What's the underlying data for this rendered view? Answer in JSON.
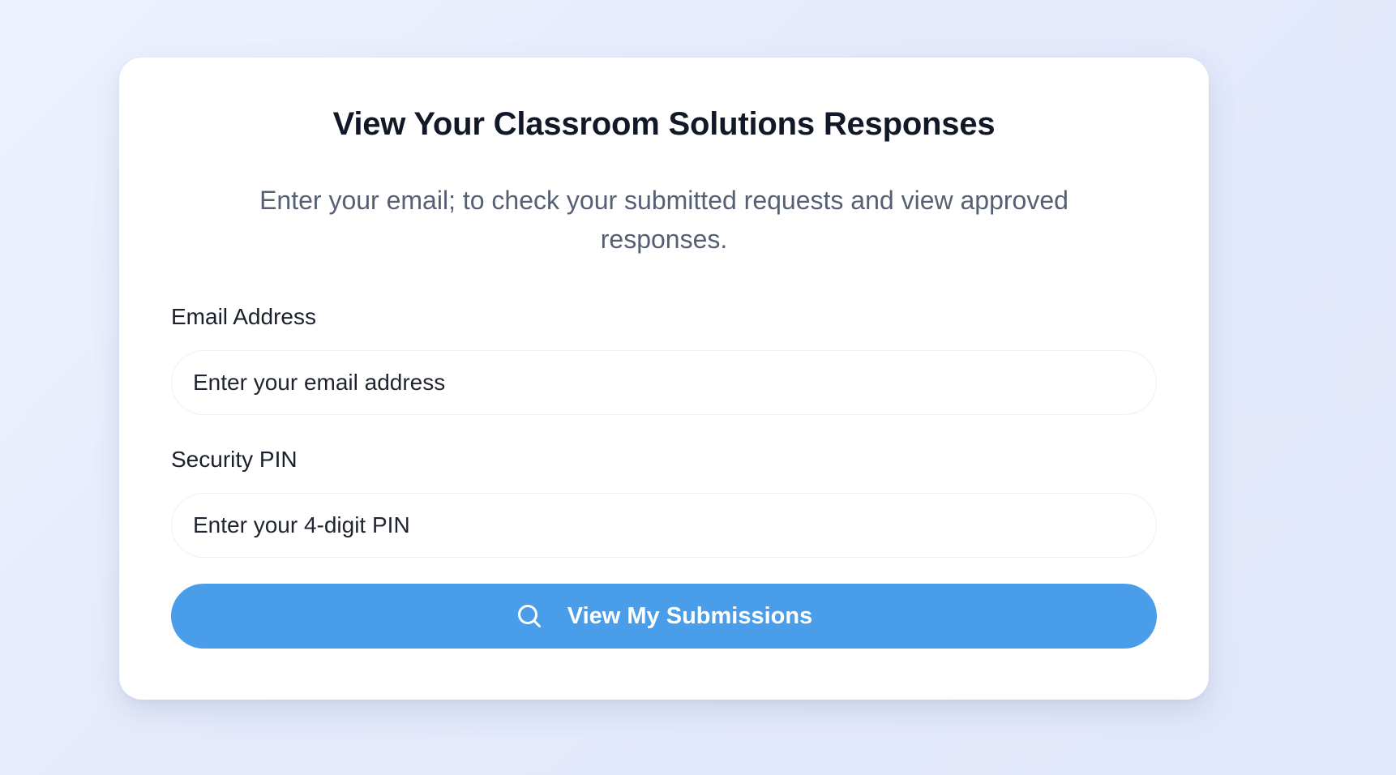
{
  "colors": {
    "page_background": "#e6ebfc",
    "card_background": "#ffffff",
    "title_text": "#111827",
    "subtitle_text": "#566074",
    "button_background": "#4a9ee9",
    "button_text": "#ffffff"
  },
  "form": {
    "title": "View Your Classroom Solutions Responses",
    "subtitle": "Enter your email; to check your submitted requests and view approved responses.",
    "email": {
      "label": "Email Address",
      "placeholder": "Enter your email address",
      "value": ""
    },
    "pin": {
      "label": "Security PIN",
      "placeholder": "Enter your 4-digit PIN",
      "value": ""
    },
    "submit": {
      "label": "View My Submissions",
      "icon": "search-icon"
    }
  }
}
